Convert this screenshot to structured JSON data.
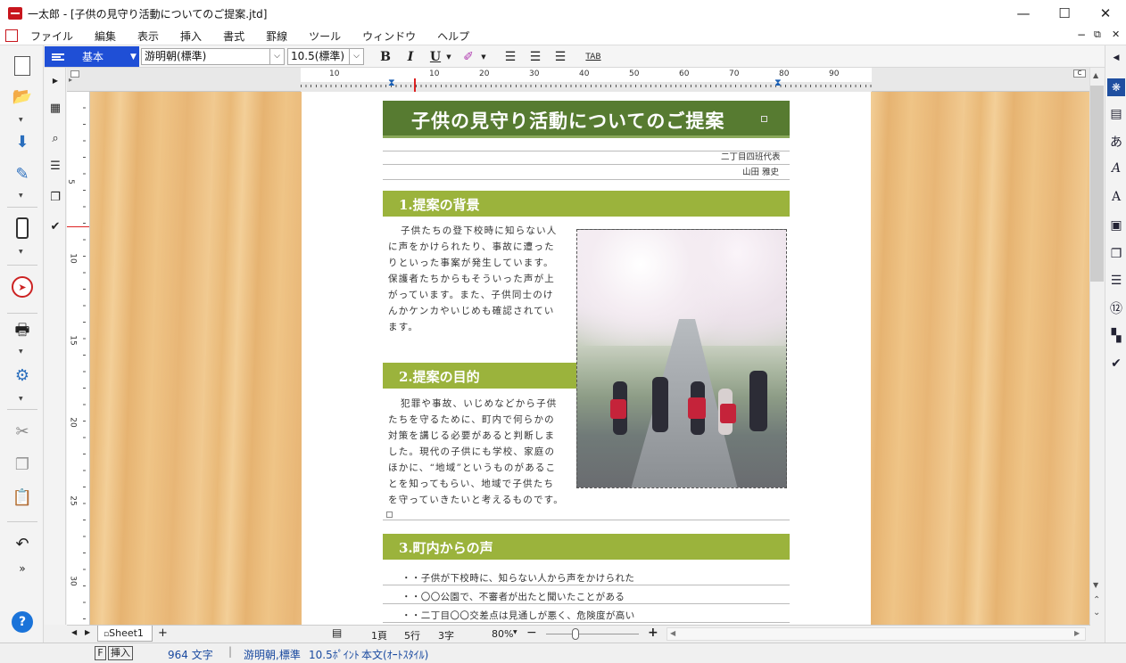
{
  "window": {
    "title": "一太郎 - [子供の見守り活動についてのご提案.jtd]",
    "minimize": "—",
    "maximize": "☐",
    "close": "✕"
  },
  "menu": [
    "ファイル",
    "編集",
    "表示",
    "挿入",
    "書式",
    "罫線",
    "ツール",
    "ウィンドウ",
    "ヘルプ"
  ],
  "fmt": {
    "style": "基本",
    "font": "游明朝(標準)",
    "size": "10.5(標準)",
    "bold": "B",
    "italic": "I",
    "underline": "U",
    "tab": "TAB"
  },
  "ruler": {
    "top": [
      "10",
      "10",
      "20",
      "30",
      "40",
      "50",
      "60",
      "70",
      "80",
      "90"
    ],
    "left": [
      "5",
      "10",
      "15",
      "20",
      "25",
      "30"
    ]
  },
  "doc": {
    "title": "子供の見守り活動についてのご提案",
    "author_org": "二丁目四班代表",
    "author_name": "山田 雅史",
    "h1": "1.提案の背景",
    "p1": [
      "子供たちの登下校時に知らない人",
      "に声をかけられたり、事故に遭った",
      "りといった事案が発生しています。",
      "保護者たちからもそういった声が上",
      "がっています。また、子供同士のけ",
      "んかケンカやいじめも確認されてい",
      "ます。"
    ],
    "h2": "2.提案の目的",
    "p2": [
      "犯罪や事故、いじめなどから子供",
      "たちを守るために、町内で何らかの",
      "対策を講じる必要があると判断しま",
      "した。現代の子供にも学校、家庭の",
      "ほかに、“地域”というものがあるこ",
      "とを知ってもらい、地域で子供たち",
      "を守っていきたいと考えるものです。"
    ],
    "h3": "3.町内からの声",
    "list": [
      "・・子供が下校時に、知らない人から声をかけられた",
      "・・〇〇公園で、不審者が出たと聞いたことがある",
      "・・二丁目〇〇交差点は見通しが悪く、危険度が高い"
    ]
  },
  "bottom": {
    "sheet": "Sheet1",
    "add": "+",
    "page": "1頁",
    "line": "5行",
    "col": "3字",
    "zoom": "80%",
    "zoom_minus": "−",
    "zoom_plus": "+"
  },
  "status": {
    "mode_key": "F",
    "mode": "挿入",
    "count": "964 文字",
    "font": "游明朝,標準",
    "size": "10.5ﾎﾟｲﾝﾄ",
    "style": "本文(ｵｰﾄｽﾀｲﾙ)"
  }
}
